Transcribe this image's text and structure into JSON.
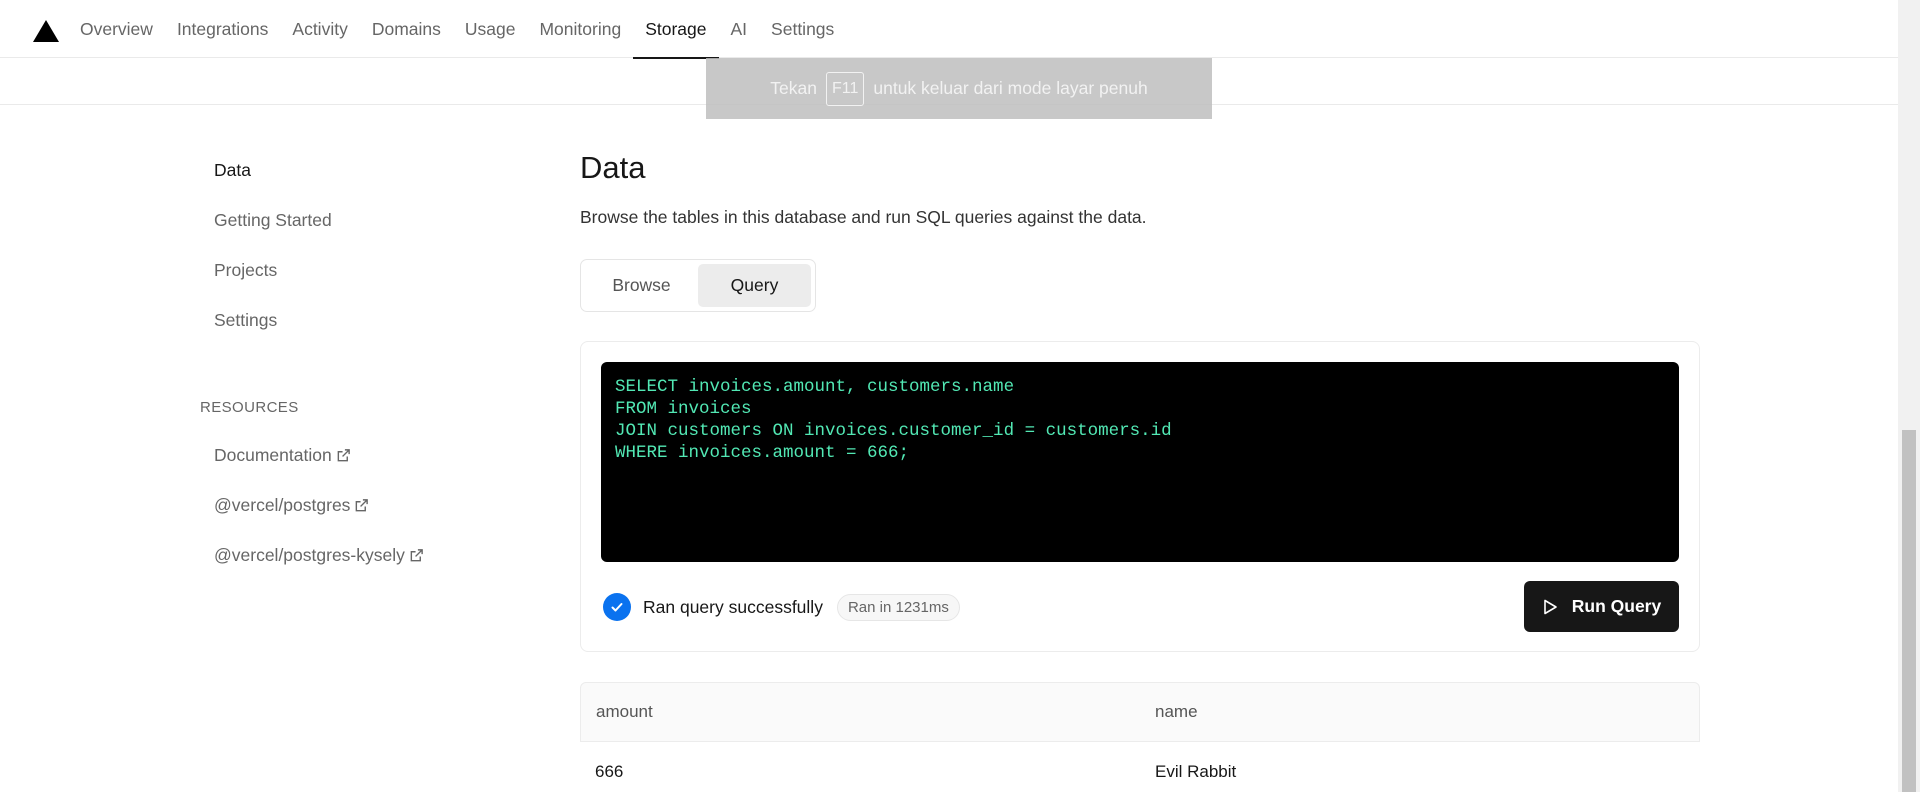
{
  "nav": {
    "tabs": [
      "Overview",
      "Integrations",
      "Activity",
      "Domains",
      "Usage",
      "Monitoring",
      "Storage",
      "AI",
      "Settings"
    ],
    "active_tab": "Storage"
  },
  "fullscreen_notice": {
    "before": "Tekan",
    "key": "F11",
    "after": "untuk keluar dari mode layar penuh"
  },
  "sidebar": {
    "items": [
      {
        "label": "Data"
      },
      {
        "label": "Getting Started"
      },
      {
        "label": "Projects"
      },
      {
        "label": "Settings"
      }
    ],
    "resources_heading": "RESOURCES",
    "resources": [
      {
        "label": "Documentation",
        "icon": "external-link-icon"
      },
      {
        "label": "@vercel/postgres",
        "icon": "external-link-icon"
      },
      {
        "label": "@vercel/postgres-kysely",
        "icon": "external-link-icon"
      }
    ]
  },
  "main": {
    "title": "Data",
    "description": "Browse the tables in this database and run SQL queries against the data.",
    "segments": [
      "Browse",
      "Query"
    ],
    "active_segment": "Query",
    "query_lines": [
      "SELECT invoices.amount, customers.name",
      "FROM invoices",
      "JOIN customers ON invoices.customer_id = customers.id",
      "WHERE invoices.amount = 666;"
    ],
    "status_text": "Ran query successfully",
    "time_badge": "Ran in 1231ms",
    "run_button": "Run Query",
    "results": {
      "columns": [
        "amount",
        "name"
      ],
      "rows": [
        [
          "666",
          "Evil Rabbit"
        ]
      ]
    }
  },
  "colors": {
    "accent": "#0a72ef",
    "code_text": "#52e8b4",
    "code_bg": "#000000",
    "button_bg": "#171717"
  }
}
